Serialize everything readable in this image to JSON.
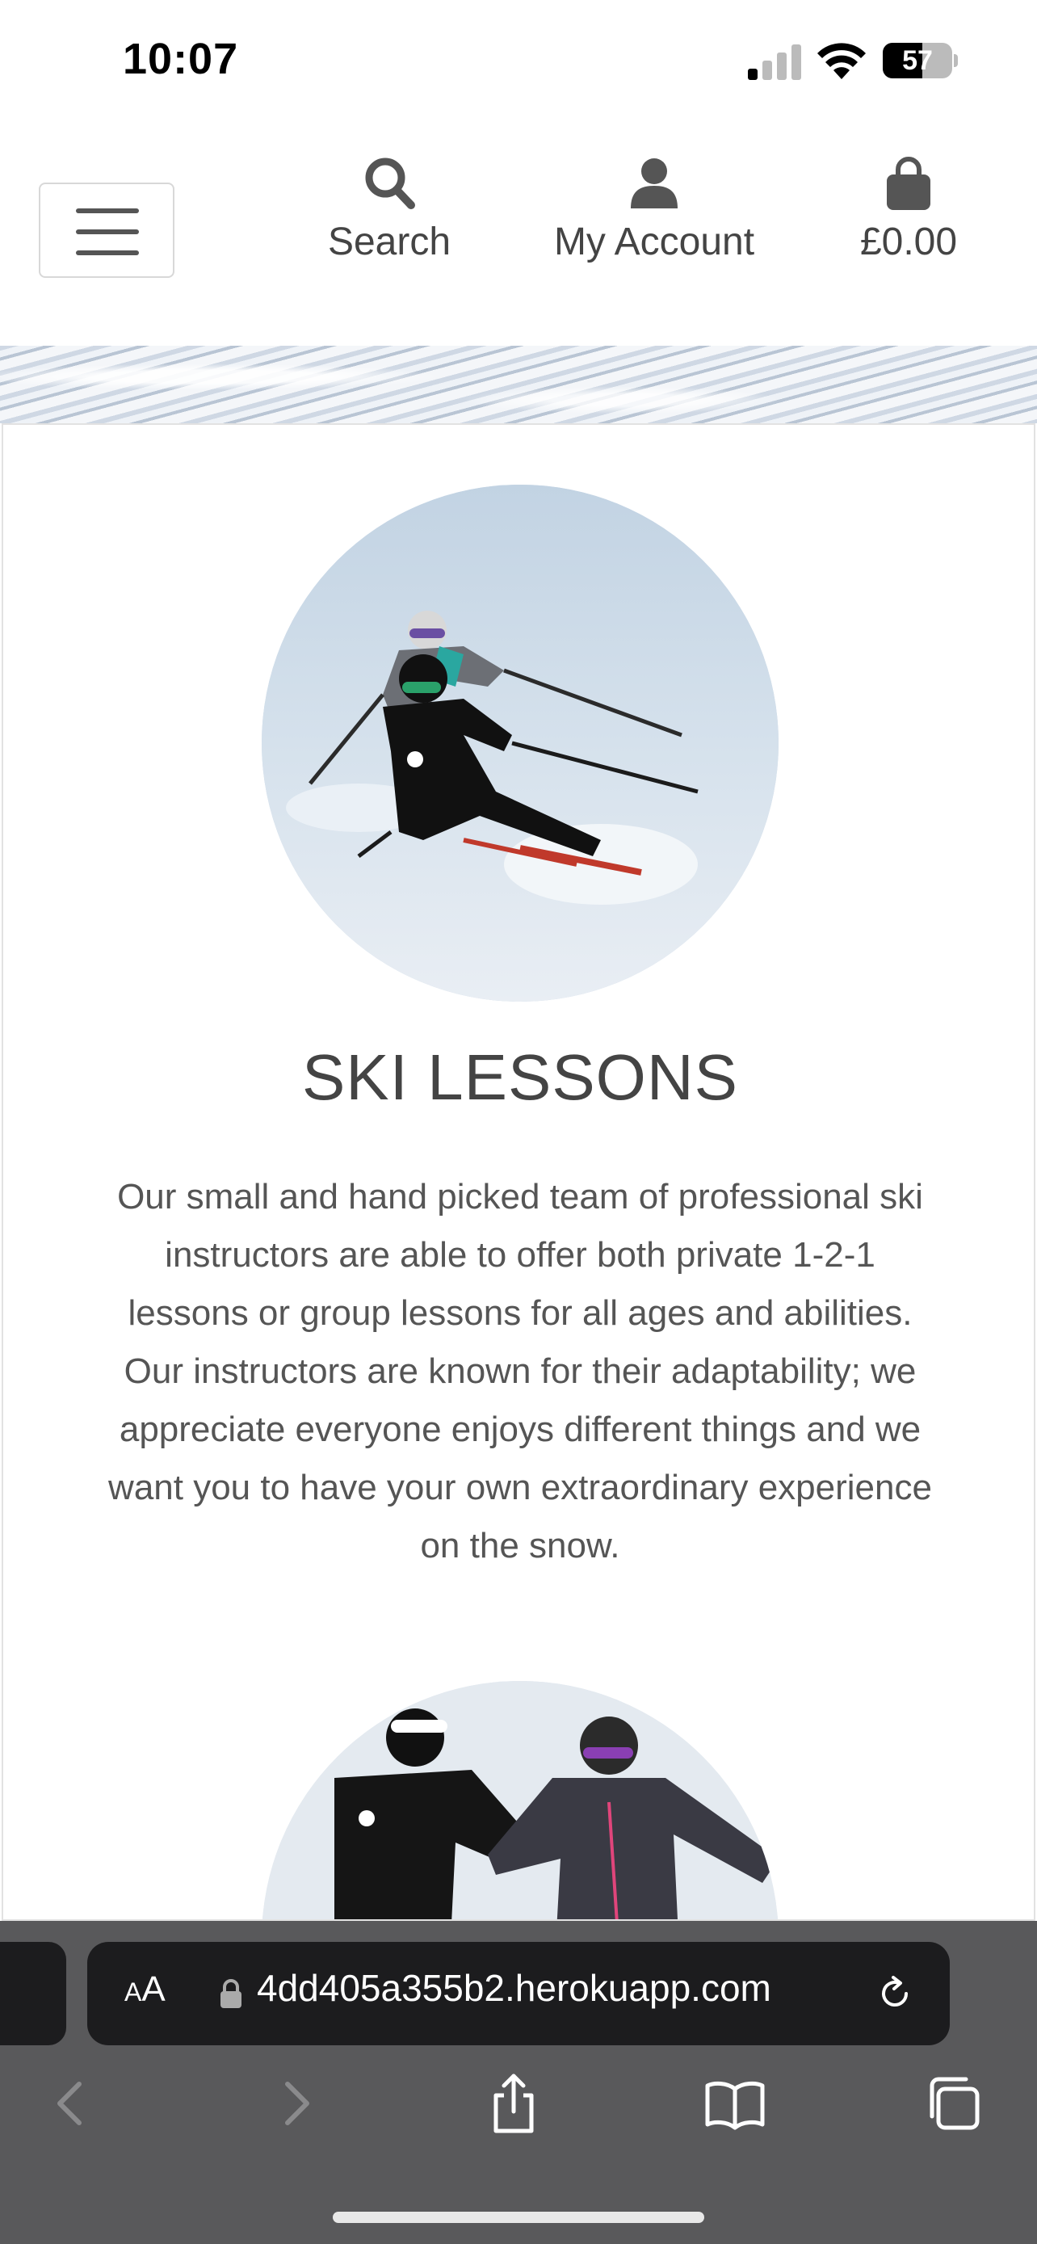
{
  "status": {
    "time": "10:07",
    "battery_level": "57"
  },
  "header": {
    "nav": {
      "search_label": "Search",
      "account_label": "My Account",
      "bag_total": "£0.00"
    }
  },
  "main": {
    "section_title": "SKI LESSONS",
    "section_body": "Our small and hand picked team of professional ski instructors are able to offer both private 1-2-1 lessons or group lessons for all ages and abilities. Our instructors are known for their adaptability; we appreciate everyone enjoys different things and we want you to have your own extraordinary experience on the snow."
  },
  "browser": {
    "text_size_label": "AA",
    "url": "4dd405a355b2.herokuapp.com"
  },
  "icons": {
    "search": "search-icon",
    "account": "user-icon",
    "bag": "shopping-bag-icon",
    "lock": "lock-icon",
    "reload": "reload-icon",
    "back": "chevron-left-icon",
    "forward": "chevron-right-icon",
    "share": "share-icon",
    "bookmarks": "book-icon",
    "tabs": "tabs-icon"
  }
}
